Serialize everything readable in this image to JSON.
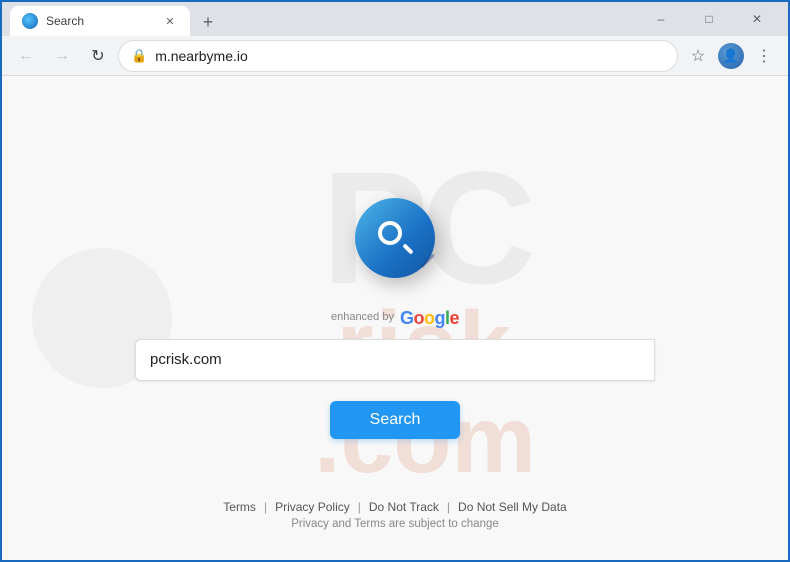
{
  "browser": {
    "tab_title": "Search",
    "url": "m.nearbyme.io",
    "new_tab_label": "+",
    "minimize_label": "–",
    "maximize_label": "□",
    "close_label": "✕"
  },
  "page": {
    "enhanced_by": "enhanced by",
    "google_text": "Google",
    "search_input_value": "pcrisk.com",
    "search_button_label": "Search",
    "footer_links": [
      "Terms",
      "Privacy Policy",
      "Do Not Track",
      "Do Not Sell My Data"
    ],
    "footer_note": "Privacy and Terms are subject to change",
    "watermark_pc": "PC",
    "watermark_risk": "risk",
    "watermark_com": ".com"
  }
}
